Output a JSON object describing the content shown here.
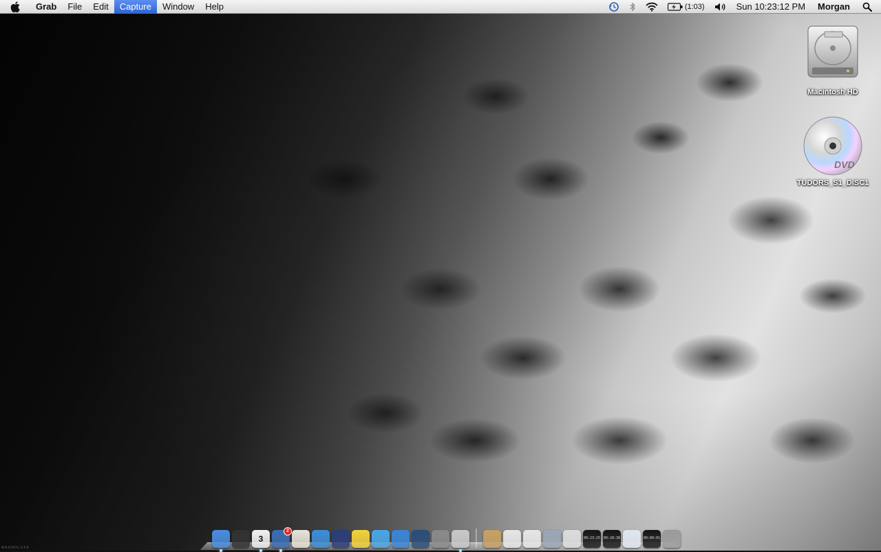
{
  "menubar": {
    "app_name": "Grab",
    "menus": [
      "File",
      "Edit",
      "Capture",
      "Window",
      "Help"
    ],
    "active_menu": "Capture",
    "status": {
      "battery_time": "(1:03)",
      "clock": "Sun 10:23:12 PM",
      "user": "Morgan"
    }
  },
  "desktop": {
    "icons": [
      {
        "label": "Macintosh HD",
        "icon": "hard-drive-icon"
      },
      {
        "label": "TUDORS_S1_DISC1",
        "icon": "dvd-icon"
      }
    ]
  },
  "dock": {
    "apps": [
      {
        "icon": "finder-icon",
        "running": true,
        "color": "#4a8fe0"
      },
      {
        "icon": "dashboard-icon",
        "running": false,
        "color": "#333333"
      },
      {
        "icon": "ical-icon",
        "running": true,
        "color": "#f2f2f2",
        "text": "3"
      },
      {
        "icon": "mail-icon",
        "running": true,
        "color": "#3b6fb6",
        "badge": "2"
      },
      {
        "icon": "textedit-icon",
        "running": false,
        "color": "#e8e4d8"
      },
      {
        "icon": "safari-icon",
        "running": false,
        "color": "#3d8fd8"
      },
      {
        "icon": "xcode-icon",
        "running": false,
        "color": "#2c3e7a"
      },
      {
        "icon": "stickies-icon",
        "running": false,
        "color": "#f2d23c"
      },
      {
        "icon": "itunes-icon",
        "running": false,
        "color": "#4aa7e6"
      },
      {
        "icon": "ichat-icon",
        "running": false,
        "color": "#3a86d8"
      },
      {
        "icon": "spaces-icon",
        "running": false,
        "color": "#2b4d7a"
      },
      {
        "icon": "system-preferences-icon",
        "running": false,
        "color": "#8a8a8a"
      },
      {
        "icon": "grab-icon",
        "running": true,
        "color": "#c9c9c9"
      }
    ],
    "docs": [
      {
        "icon": "folder-stack-icon",
        "color": "#c8a060"
      },
      {
        "icon": "document-icon",
        "color": "#e6e6e6"
      },
      {
        "icon": "document-icon",
        "color": "#e6e6e6"
      },
      {
        "icon": "window-thumbnail-icon",
        "color": "#9aa6b6"
      },
      {
        "icon": "window-thumbnail-icon",
        "color": "#dcdcdc"
      },
      {
        "icon": "timer-window-icon",
        "color": "#151515",
        "text": "00:23:25"
      },
      {
        "icon": "timer-window-icon",
        "color": "#151515",
        "text": "00:28:38"
      },
      {
        "icon": "window-thumbnail-icon",
        "color": "#e0e6ee"
      },
      {
        "icon": "timer-window-icon",
        "color": "#151515",
        "text": "00:00:01"
      },
      {
        "icon": "trash-icon",
        "color": "#9a9a9a"
      }
    ]
  },
  "watermark": "MAGNOLUXE"
}
